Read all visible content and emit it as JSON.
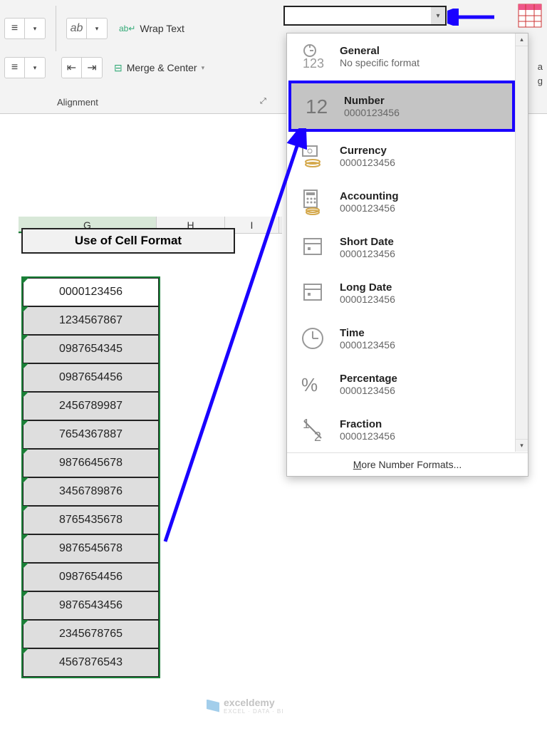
{
  "ribbon": {
    "wrap_text": "Wrap Text",
    "merge_center": "Merge & Center",
    "alignment_label": "Alignment"
  },
  "format_combo": {
    "value": ""
  },
  "columns": [
    "G",
    "H",
    "I"
  ],
  "title": "Use of Cell Format",
  "data": [
    "0000123456",
    "1234567867",
    "0987654345",
    "0987654456",
    "2456789987",
    "7654367887",
    "9876645678",
    "3456789876",
    "8765435678",
    "9876545678",
    "0987654456",
    "9876543456",
    "2345678765",
    "4567876543"
  ],
  "dropdown": {
    "items": [
      {
        "title": "General",
        "sub": "No specific format",
        "icon": "general"
      },
      {
        "title": "Number",
        "sub": "0000123456",
        "icon": "number",
        "highlight": true
      },
      {
        "title": "Currency",
        "sub": "0000123456",
        "icon": "currency"
      },
      {
        "title": "Accounting",
        "sub": " 0000123456",
        "icon": "accounting"
      },
      {
        "title": "Short Date",
        "sub": "0000123456",
        "icon": "shortdate"
      },
      {
        "title": "Long Date",
        "sub": "0000123456",
        "icon": "longdate"
      },
      {
        "title": "Time",
        "sub": "0000123456",
        "icon": "time"
      },
      {
        "title": "Percentage",
        "sub": "0000123456",
        "icon": "percentage"
      },
      {
        "title": "Fraction",
        "sub": "0000123456",
        "icon": "fraction"
      }
    ],
    "more": "More Number Formats..."
  },
  "watermark": {
    "name": "exceldemy",
    "sub": "EXCEL · DATA · BI"
  }
}
